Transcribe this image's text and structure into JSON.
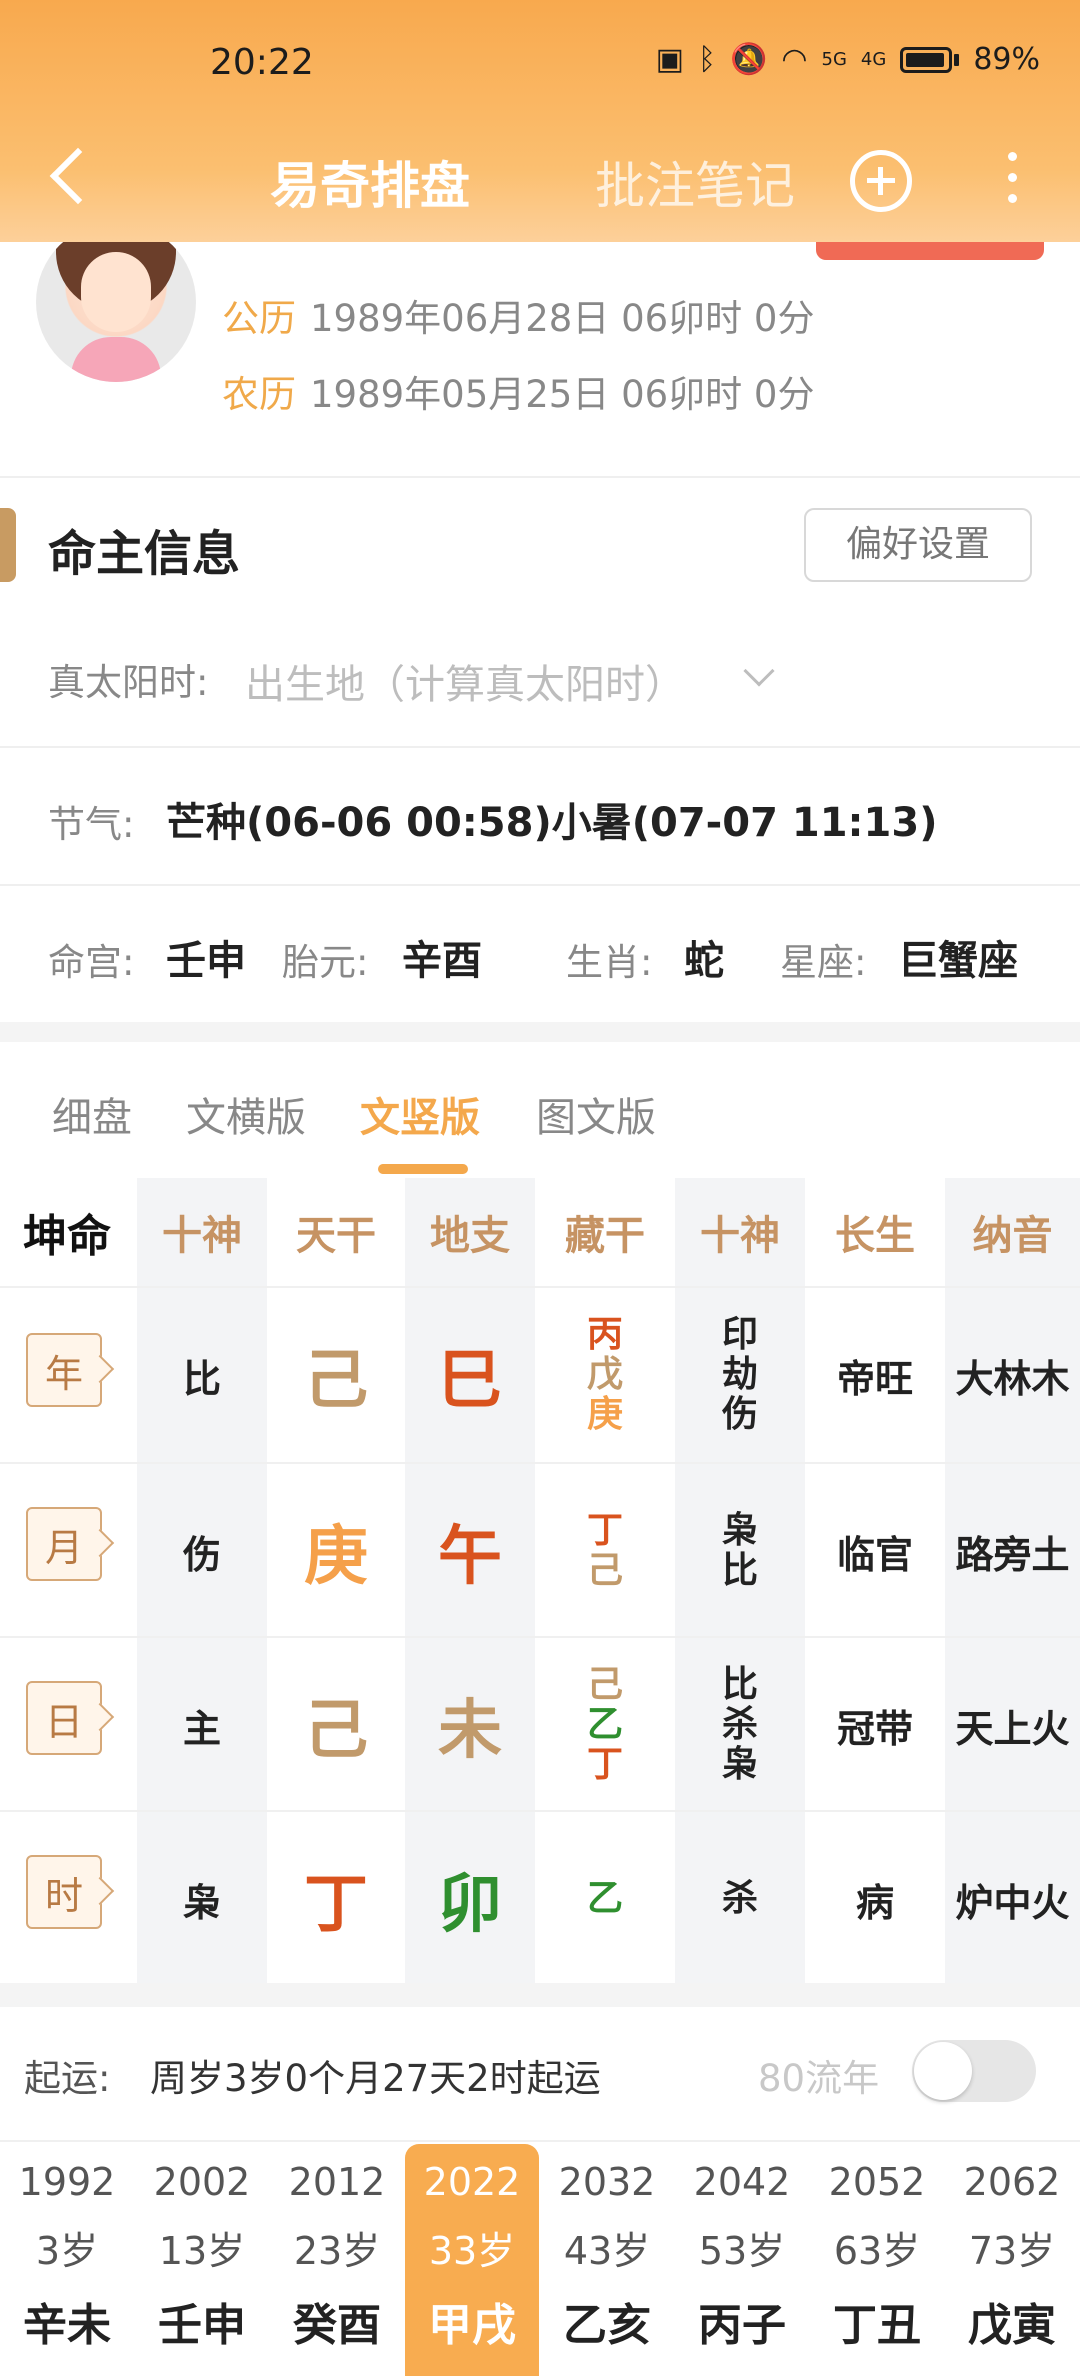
{
  "status_bar": {
    "time": "20:22",
    "battery": "89%",
    "net1": "5G",
    "net2": "4G"
  },
  "nav": {
    "title": "易奇排盘",
    "notes": "批注笔记"
  },
  "profile": {
    "solar_label": "公历",
    "solar_value": "1989年06月28日 06卯时 0分",
    "lunar_label": "农历",
    "lunar_value": "1989年05月25日 06卯时 0分"
  },
  "owner": {
    "title": "命主信息",
    "pref_button": "偏好设置",
    "true_solar_label": "真太阳时:",
    "true_solar_placeholder": "出生地（计算真太阳时）",
    "solar_term_label": "节气:",
    "solar_term_value": "芒种(06-06 00:58)小暑(07-07 11:13)",
    "ming_gong_label": "命宫:",
    "ming_gong_value": "壬申",
    "tai_yuan_label": "胎元:",
    "tai_yuan_value": "辛酉",
    "zodiac_label": "生肖:",
    "zodiac_value": "蛇",
    "star_label": "星座:",
    "star_value": "巨蟹座"
  },
  "tabs": [
    "细盘",
    "文横版",
    "文竖版",
    "图文版"
  ],
  "grid": {
    "headers": [
      "坤命",
      "十神",
      "天干",
      "地支",
      "藏干",
      "十神",
      "长生",
      "纳音"
    ],
    "rows": [
      {
        "pillar": "年",
        "shishen": "比",
        "gan": "己",
        "zhi": "巳",
        "canggan": [
          "丙",
          "戊",
          "庚"
        ],
        "shishen2": [
          "印",
          "劫",
          "伤"
        ],
        "changsheng": "帝旺",
        "nayin": "大林木"
      },
      {
        "pillar": "月",
        "shishen": "伤",
        "gan": "庚",
        "zhi": "午",
        "canggan": [
          "丁",
          "己"
        ],
        "shishen2": [
          "枭",
          "比"
        ],
        "changsheng": "临官",
        "nayin": "路旁土"
      },
      {
        "pillar": "日",
        "shishen": "主",
        "gan": "己",
        "zhi": "未",
        "canggan": [
          "己",
          "乙",
          "丁"
        ],
        "shishen2": [
          "比",
          "杀",
          "枭"
        ],
        "changsheng": "冠带",
        "nayin": "天上火"
      },
      {
        "pillar": "时",
        "shishen": "枭",
        "gan": "丁",
        "zhi": "卯",
        "canggan": [
          "乙"
        ],
        "shishen2": [
          "杀"
        ],
        "changsheng": "病",
        "nayin": "炉中火"
      }
    ],
    "colors": {
      "earth": "#c19a6b",
      "metal": "#f5a04a",
      "fire": "#d9531e",
      "wood": "#2f8f2f"
    }
  },
  "luck": {
    "label": "起运:",
    "value": "周岁3岁0个月27天2时起运",
    "flow_label": "80流年",
    "flow_on": false,
    "decades": [
      {
        "year": "1992",
        "age": "3岁",
        "gz": "辛未",
        "active": false
      },
      {
        "year": "2002",
        "age": "13岁",
        "gz": "壬申",
        "active": false
      },
      {
        "year": "2012",
        "age": "23岁",
        "gz": "癸酉",
        "active": false
      },
      {
        "year": "2022",
        "age": "33岁",
        "gz": "甲戌",
        "active": true
      },
      {
        "year": "2032",
        "age": "43岁",
        "gz": "乙亥",
        "active": false
      },
      {
        "year": "2042",
        "age": "53岁",
        "gz": "丙子",
        "active": false
      },
      {
        "year": "2052",
        "age": "63岁",
        "gz": "丁丑",
        "active": false
      },
      {
        "year": "2062",
        "age": "73岁",
        "gz": "戊寅",
        "active": false
      }
    ]
  }
}
